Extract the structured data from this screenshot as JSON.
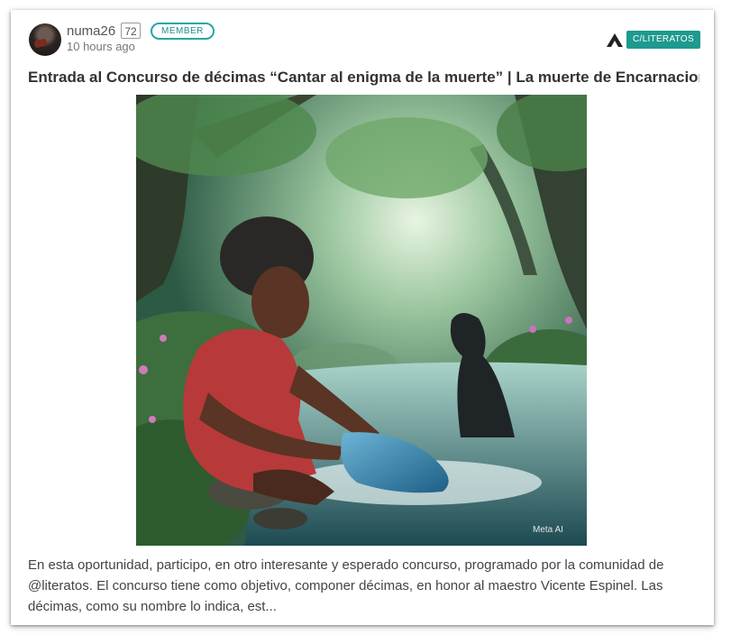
{
  "post": {
    "author": "numa26",
    "reputation": "72",
    "badge": "MEMBER",
    "time": "10 hours ago",
    "community": "C/LITERATOS",
    "title": "Entrada al Concurso de décimas “Cantar al enigma de la muerte” | La muerte de Encarnacion...",
    "image_watermark": "Meta AI",
    "excerpt": "En esta oportunidad, participo, en otro interesante y esperado concurso, programado por la comunidad de @literatos. El concurso tiene como objetivo, componer décimas, en honor al maestro Vicente Espinel. Las décimas, como su nombre lo indica, est..."
  },
  "colors": {
    "accent": "#1e9a8e",
    "badge_border": "#27a6a6"
  },
  "icons": {
    "community": "community-peak-icon"
  }
}
